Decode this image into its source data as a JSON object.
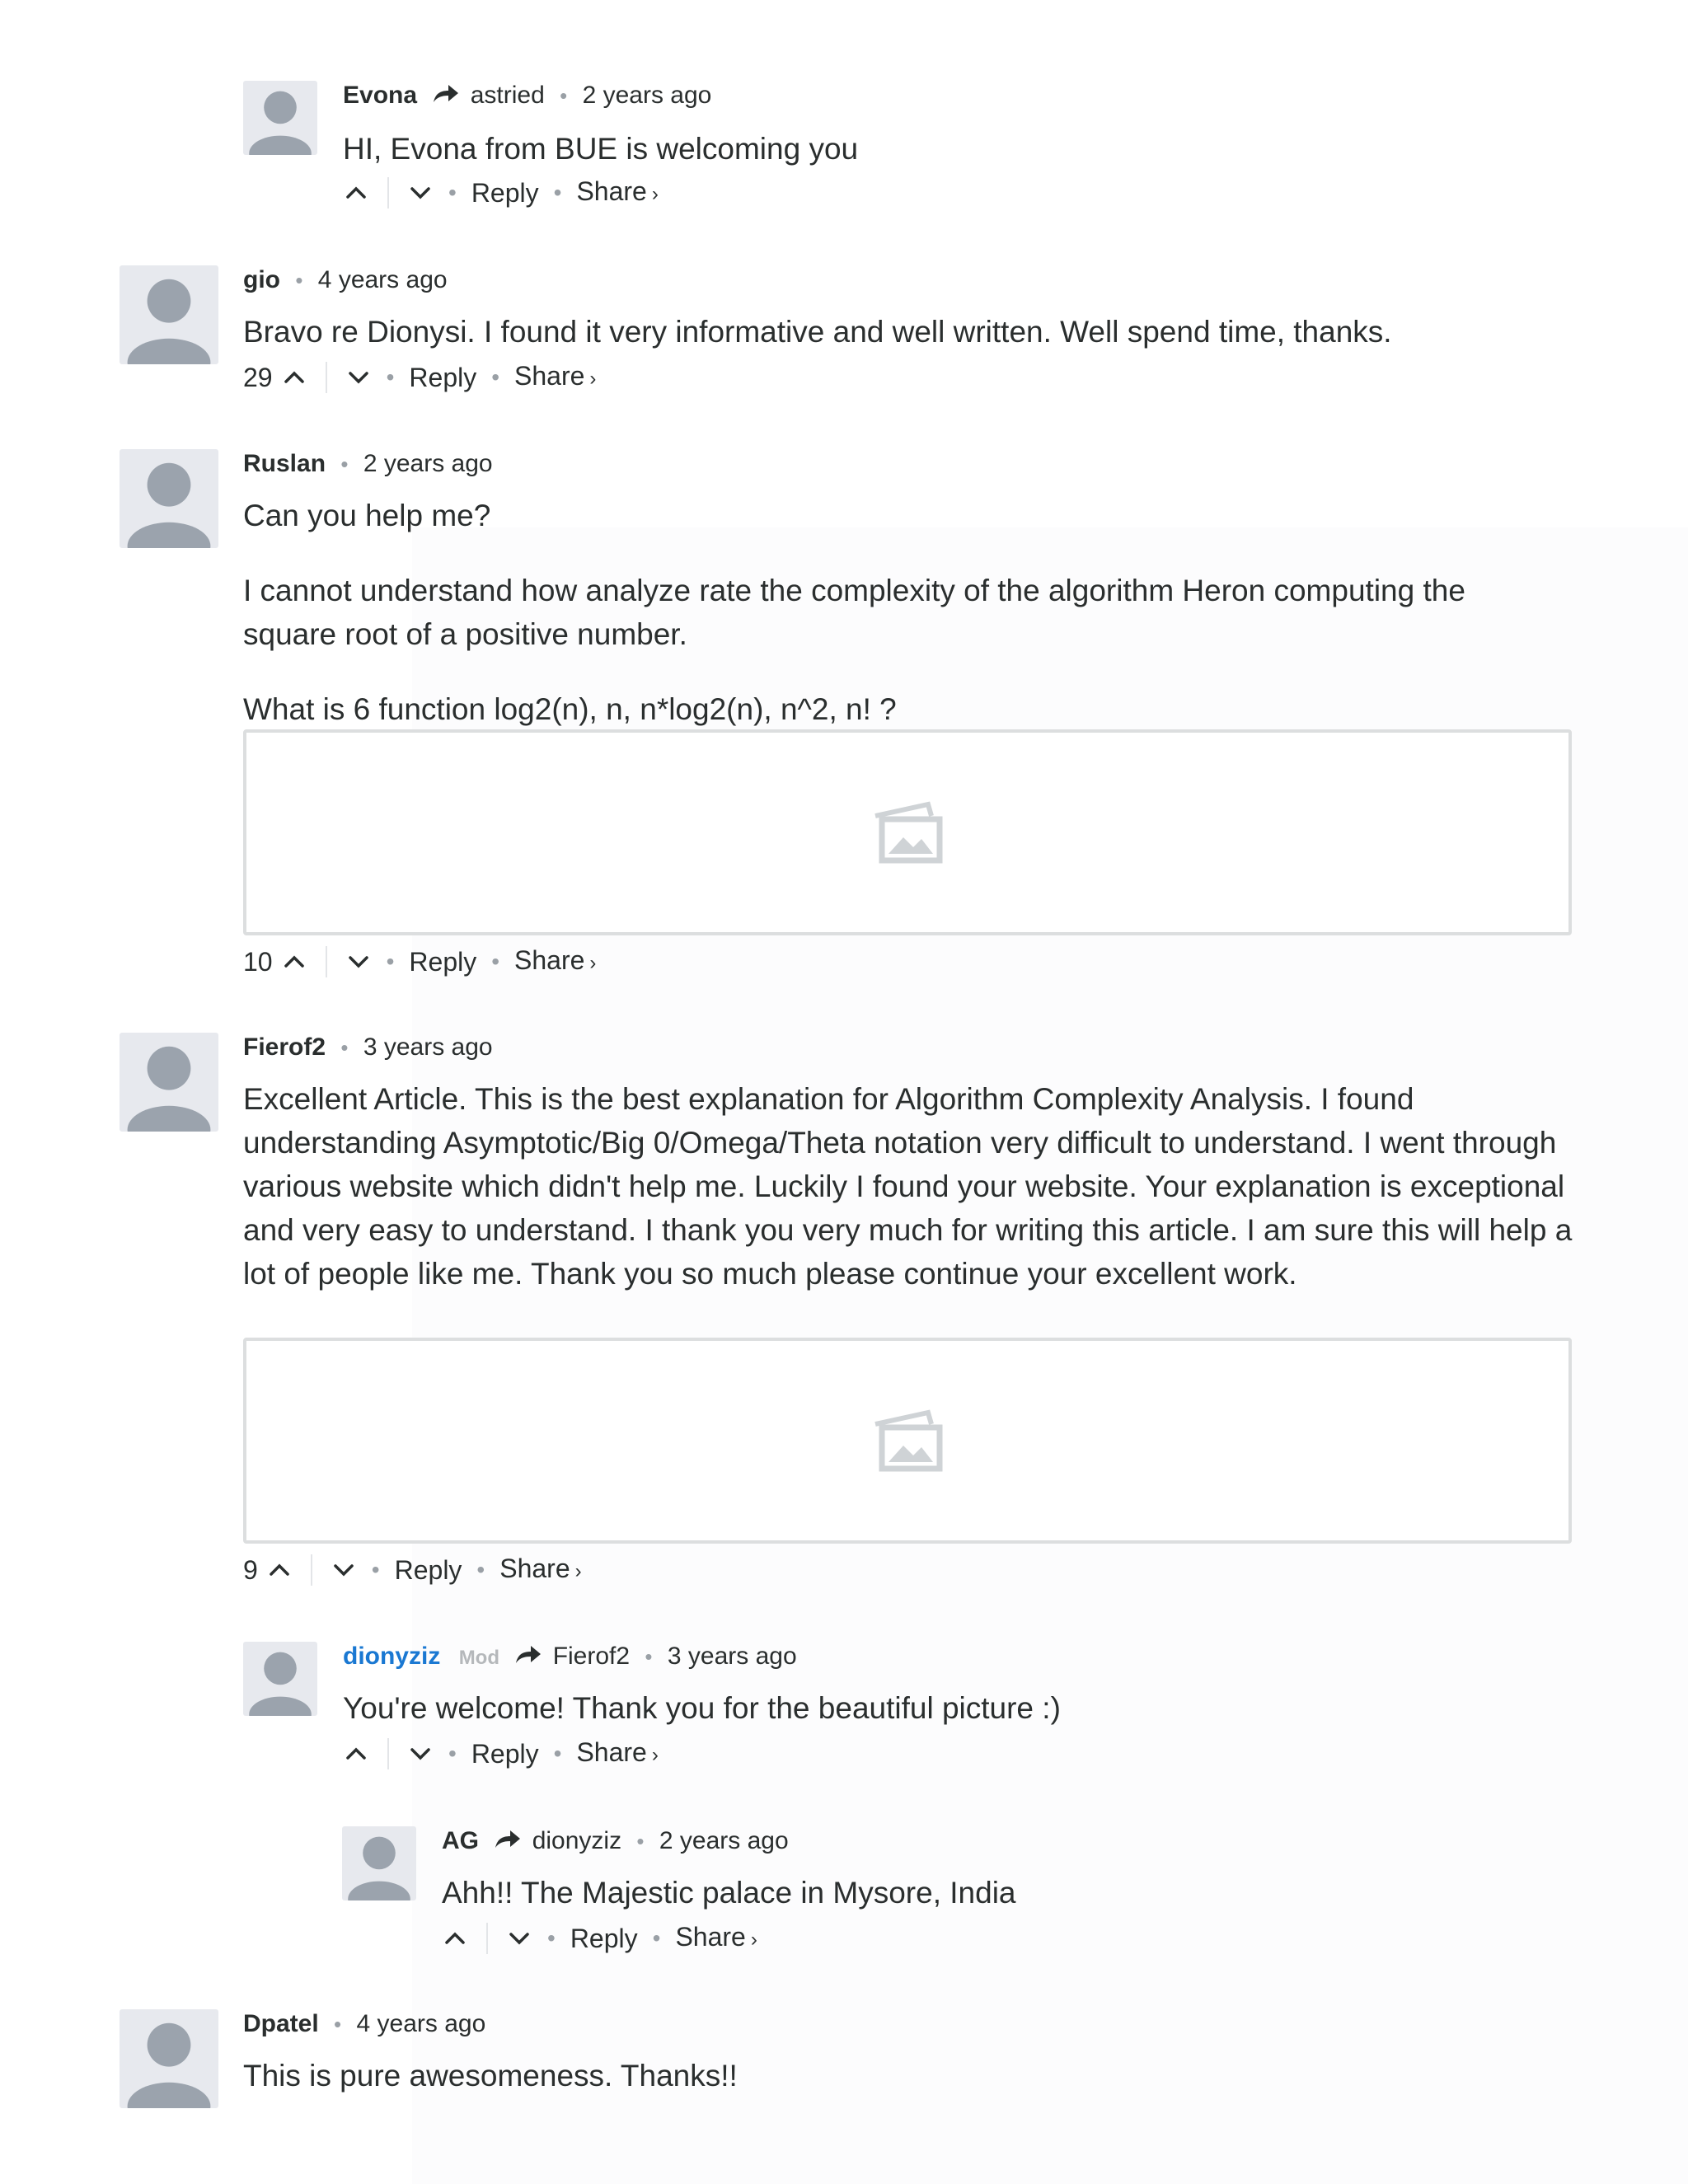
{
  "colors": {
    "text": "#2a2e2e",
    "mod_name": "#1a78d2",
    "muted": "#9aa0a6",
    "avatar_bg": "#e7e9ee",
    "avatar_fg": "#9ba3ad"
  },
  "icons": {
    "avatar": "user-silhouette-icon",
    "reply_to": "reply-arrow-icon",
    "upvote": "chevron-up-icon",
    "downvote": "chevron-down-icon",
    "image": "image-placeholder-icon"
  },
  "comments": [
    {
      "author": "Evona",
      "parent": "astried",
      "time": "2 years ago",
      "text": "HI, Evona from BUE is welcoming you",
      "votes": "",
      "reply": "Reply",
      "share": "Share"
    },
    {
      "author": "gio",
      "time": "4 years ago",
      "text": "Bravo re Dionysi. I found it very informative and well written. Well spend time, thanks.",
      "votes": "29",
      "reply": "Reply",
      "share": "Share"
    },
    {
      "author": "Ruslan",
      "time": "2 years ago",
      "paragraphs": [
        "Can you help me?",
        "I cannot understand how analyze rate the complexity of the algorithm Heron computing the square root of a positive number.",
        "What is 6 function log2(n), n, n*log2(n), n^2, n! ?"
      ],
      "votes": "10",
      "reply": "Reply",
      "share": "Share"
    },
    {
      "author": "Fierof2",
      "time": "3 years ago",
      "text": "Excellent Article. This is the best explanation for Algorithm Complexity Analysis. I found understanding Asymptotic/Big 0/Omega/Theta notation very difficult to understand. I went through various website which didn't help me. Luckily I found your website. Your explanation is exceptional and very easy to understand. I thank you very much for writing this article. I am sure this will help a lot of people like me. Thank you so much please continue your excellent work.",
      "votes": "9",
      "reply": "Reply",
      "share": "Share"
    },
    {
      "author": "dionyziz",
      "badge": "Mod",
      "parent": "Fierof2",
      "time": "3 years ago",
      "text": "You're welcome! Thank you for the beautiful picture :)",
      "votes": "",
      "reply": "Reply",
      "share": "Share"
    },
    {
      "author": "AG",
      "parent": "dionyziz",
      "time": "2 years ago",
      "text": "Ahh!! The Majestic palace in Mysore, India",
      "votes": "",
      "reply": "Reply",
      "share": "Share"
    },
    {
      "author": "Dpatel",
      "time": "4 years ago",
      "text": "This is pure awesomeness. Thanks!!"
    }
  ]
}
